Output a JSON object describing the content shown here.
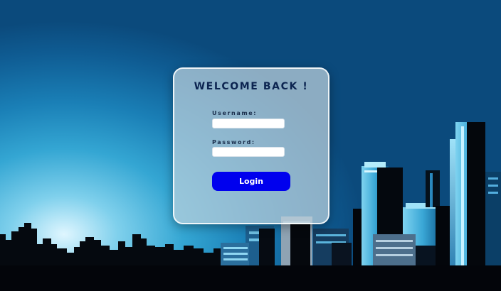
{
  "login_card": {
    "title": "WELCOME BACK !",
    "username_label": "Username:",
    "username_value": "",
    "password_label": "Password:",
    "password_value": "",
    "login_label": "Login"
  },
  "colors": {
    "login_button": "#0000ee",
    "title_text": "#0c2450",
    "sky_top": "#0b4a7c",
    "sky_glow": "#dff6ff"
  }
}
